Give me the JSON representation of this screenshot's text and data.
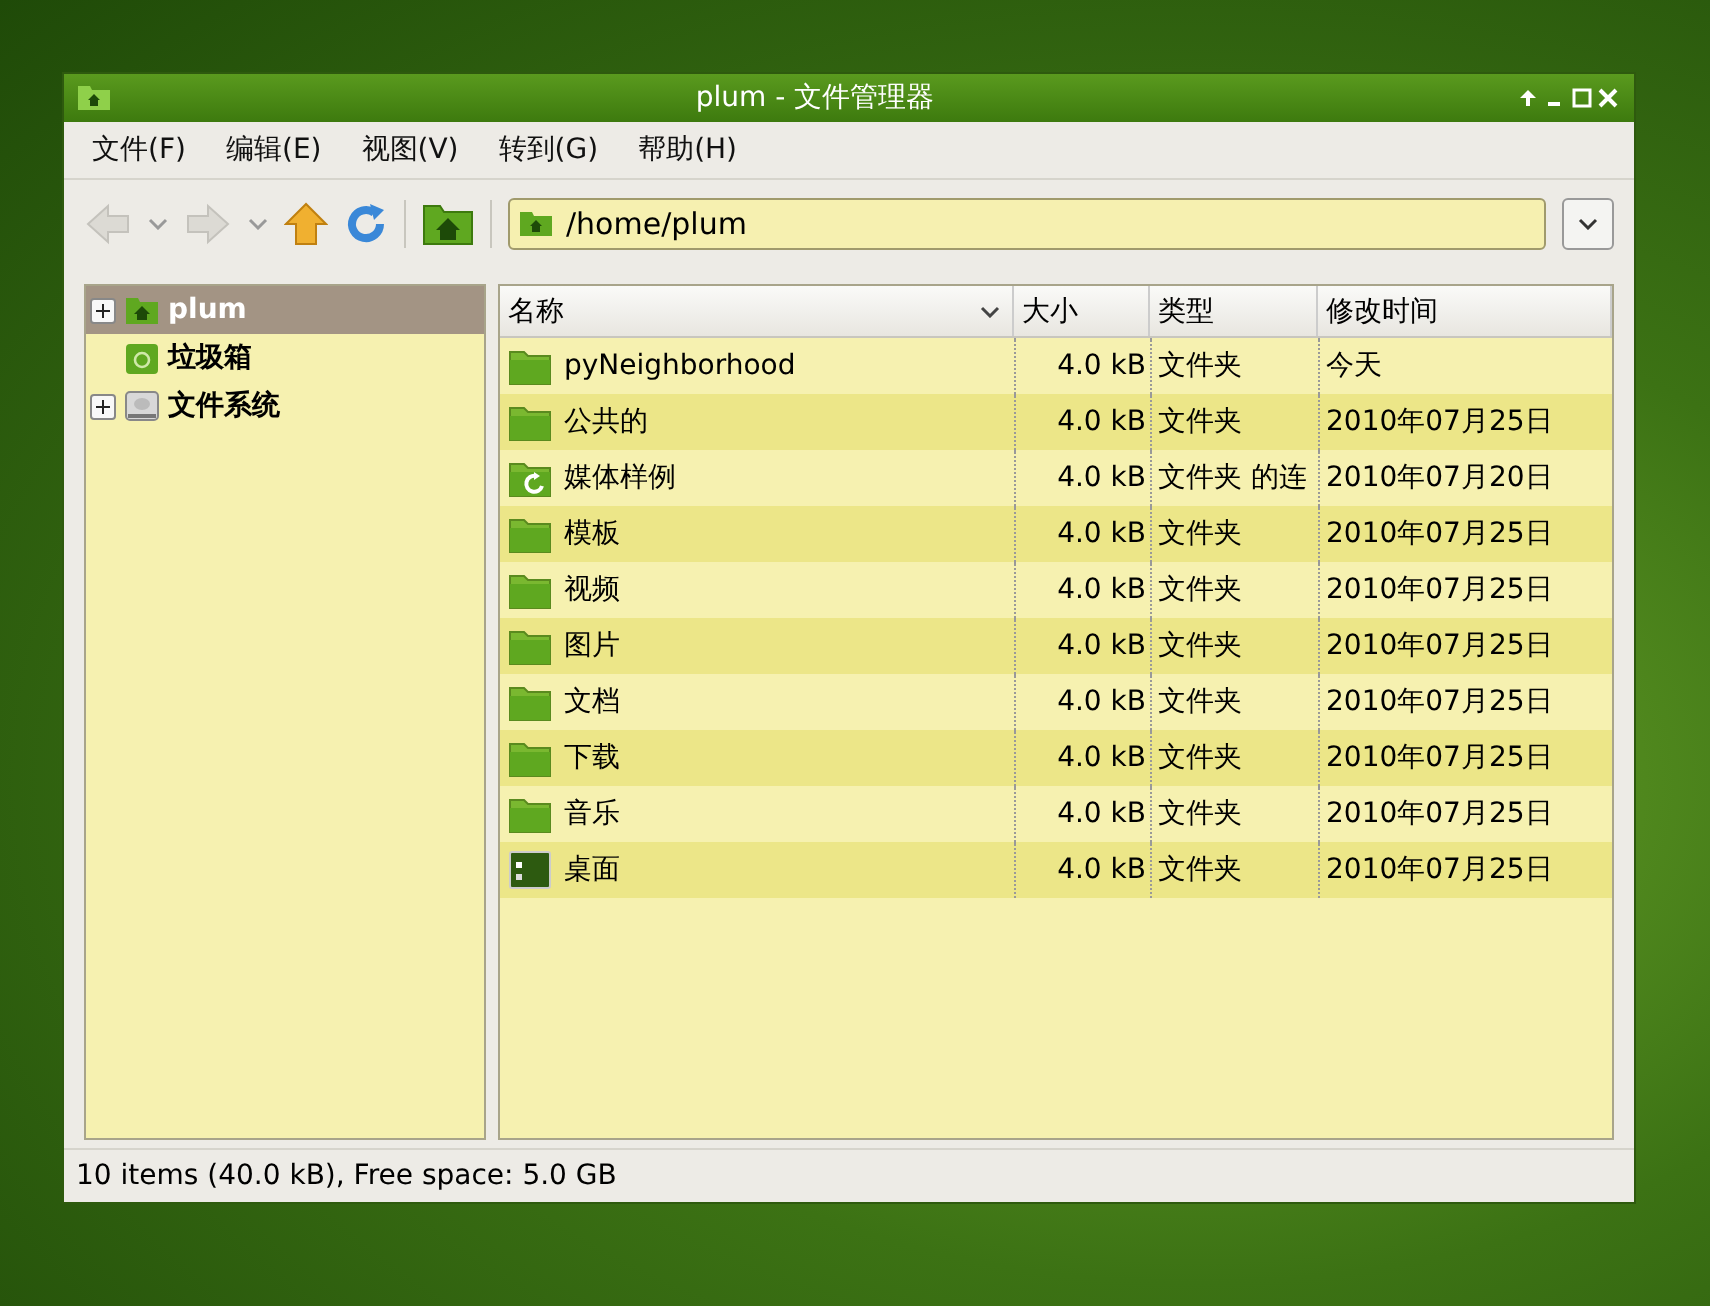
{
  "window": {
    "title": "plum - 文件管理器"
  },
  "menu": [
    {
      "label": "文件(F)"
    },
    {
      "label": "编辑(E)"
    },
    {
      "label": "视图(V)"
    },
    {
      "label": "转到(G)"
    },
    {
      "label": "帮助(H)"
    }
  ],
  "toolbar": {
    "back_disabled": true,
    "forward_disabled": true,
    "location": "/home/plum"
  },
  "sidebar": {
    "items": [
      {
        "label": "plum",
        "kind": "home",
        "selected": true,
        "expandable": true
      },
      {
        "label": "垃圾箱",
        "kind": "trash",
        "selected": false,
        "expandable": false
      },
      {
        "label": "文件系统",
        "kind": "drive",
        "selected": false,
        "expandable": true
      }
    ]
  },
  "table": {
    "columns": [
      "名称",
      "大小",
      "类型",
      "修改时间"
    ],
    "rows": [
      {
        "kind": "folder",
        "name": "pyNeighborhood",
        "size": "4.0 kB",
        "type": "文件夹",
        "modified": "今天"
      },
      {
        "kind": "folder",
        "name": "公共的",
        "size": "4.0 kB",
        "type": "文件夹",
        "modified": "2010年07月25日"
      },
      {
        "kind": "link",
        "name": "媒体样例",
        "size": "4.0 kB",
        "type": "文件夹 的连",
        "modified": "2010年07月20日"
      },
      {
        "kind": "folder",
        "name": "模板",
        "size": "4.0 kB",
        "type": "文件夹",
        "modified": "2010年07月25日"
      },
      {
        "kind": "folder",
        "name": "视频",
        "size": "4.0 kB",
        "type": "文件夹",
        "modified": "2010年07月25日"
      },
      {
        "kind": "folder",
        "name": "图片",
        "size": "4.0 kB",
        "type": "文件夹",
        "modified": "2010年07月25日"
      },
      {
        "kind": "folder",
        "name": "文档",
        "size": "4.0 kB",
        "type": "文件夹",
        "modified": "2010年07月25日"
      },
      {
        "kind": "folder",
        "name": "下载",
        "size": "4.0 kB",
        "type": "文件夹",
        "modified": "2010年07月25日"
      },
      {
        "kind": "folder",
        "name": "音乐",
        "size": "4.0 kB",
        "type": "文件夹",
        "modified": "2010年07月25日"
      },
      {
        "kind": "desktop",
        "name": "桌面",
        "size": "4.0 kB",
        "type": "文件夹",
        "modified": "2010年07月25日"
      }
    ]
  },
  "status_bar": "10 items (40.0 kB), Free space: 5.0 GB"
}
